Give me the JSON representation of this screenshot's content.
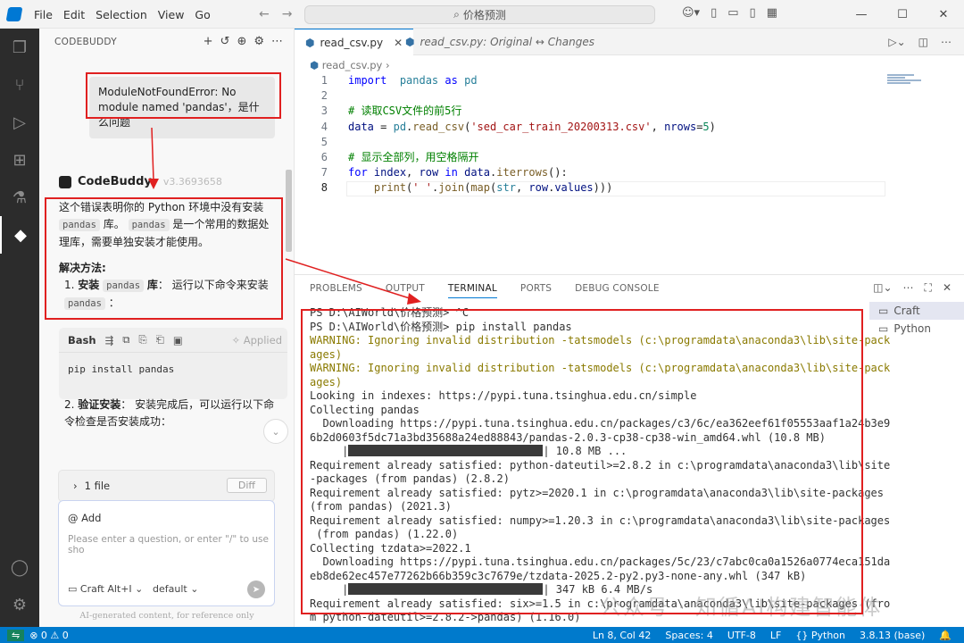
{
  "titlebar": {
    "menu": [
      "File",
      "Edit",
      "Selection",
      "View",
      "Go"
    ],
    "search": "价格预测"
  },
  "sidebar": {
    "title": "CODEBUDDY",
    "user_question": "ModuleNotFoundError: No module named 'pandas'，是什么问题",
    "assistant_name": "CodeBuddy",
    "assistant_version": "v3.3693658",
    "answer": {
      "p1_a": "这个错误表明你的 Python 环境中没有安装",
      "chip1": "pandas",
      "p1_b": "库。",
      "chip2": "pandas",
      "p1_c": "是一个常用的数据处理库，需要单独安装才能使用。",
      "solution_heading": "解决方法:",
      "step1_num": "1.",
      "step1_bold": "安装",
      "step1_chip": "pandas",
      "step1_bold2": "库",
      "step1_text": "： 运行以下命令来安装",
      "step1_chip2": "pandas",
      "step1_end": "："
    },
    "codeblock": {
      "lang": "Bash",
      "applied": "Applied",
      "code": "pip install pandas"
    },
    "step2": {
      "num": "2.",
      "bold": "验证安装",
      "text": "： 安装完成后，可以运行以下命令检查是否安装成功："
    },
    "files": {
      "label": "1 file",
      "diff": "Diff"
    },
    "chat": {
      "at": "@ Add",
      "placeholder": "Please enter a question, or enter \"/\" to use sho",
      "mode": "Craft Alt+I",
      "model": "default"
    },
    "disclaimer": "AI-generated content, for reference only"
  },
  "tabs": [
    {
      "label": "read_csv.py"
    },
    {
      "label": "read_csv.py: Original ↔ Changes"
    }
  ],
  "breadcrumb": "read_csv.py",
  "editor_lines": [
    {
      "n": "1",
      "code": [
        [
          "kw",
          "import"
        ],
        [
          "",
          "  "
        ],
        [
          "bi",
          "pandas"
        ],
        [
          "",
          " "
        ],
        [
          "kw",
          "as"
        ],
        [
          "",
          " "
        ],
        [
          "bi",
          "pd"
        ]
      ]
    },
    {
      "n": "2",
      "code": []
    },
    {
      "n": "3",
      "code": [
        [
          "cm",
          "# 读取CSV文件的前5行"
        ]
      ]
    },
    {
      "n": "4",
      "code": [
        [
          "var",
          "data"
        ],
        [
          "",
          " = "
        ],
        [
          "bi",
          "pd"
        ],
        [
          "",
          "."
        ],
        [
          "fn",
          "read_csv"
        ],
        [
          "",
          "("
        ],
        [
          "str",
          "'sed_car_train_20200313.csv'"
        ],
        [
          "",
          ", "
        ],
        [
          "var",
          "nrows"
        ],
        [
          "",
          "="
        ],
        [
          "num",
          "5"
        ],
        [
          "",
          ")"
        ]
      ]
    },
    {
      "n": "5",
      "code": []
    },
    {
      "n": "6",
      "code": [
        [
          "cm",
          "# 显示全部列，用空格隔开"
        ]
      ]
    },
    {
      "n": "7",
      "code": [
        [
          "kw",
          "for"
        ],
        [
          "",
          " "
        ],
        [
          "var",
          "index"
        ],
        [
          "",
          ", "
        ],
        [
          "var",
          "row"
        ],
        [
          "",
          " "
        ],
        [
          "kw",
          "in"
        ],
        [
          "",
          " "
        ],
        [
          "var",
          "data"
        ],
        [
          "",
          "."
        ],
        [
          "fn",
          "iterrows"
        ],
        [
          "",
          "():"
        ]
      ]
    },
    {
      "n": "8",
      "code": [
        [
          "",
          "    "
        ],
        [
          "fn",
          "print"
        ],
        [
          "",
          "("
        ],
        [
          "str",
          "' '"
        ],
        [
          "",
          "."
        ],
        [
          "fn",
          "join"
        ],
        [
          "",
          "("
        ],
        [
          "fn",
          "map"
        ],
        [
          "",
          "("
        ],
        [
          "bi",
          "str"
        ],
        [
          "",
          ", "
        ],
        [
          "var",
          "row"
        ],
        [
          "",
          "."
        ],
        [
          "var",
          "values"
        ],
        [
          "",
          ")))"
        ]
      ]
    }
  ],
  "panel": {
    "tabs": [
      "PROBLEMS",
      "OUTPUT",
      "TERMINAL",
      "PORTS",
      "DEBUG CONSOLE"
    ],
    "active_tab": "TERMINAL",
    "terminals": [
      "Craft",
      "Python"
    ]
  },
  "terminal_lines": [
    {
      "t": "n",
      "s": "PS D:\\AIWorld\\价格预测> ^C"
    },
    {
      "t": "n",
      "s": "PS D:\\AIWorld\\价格预测> pip install pandas"
    },
    {
      "t": "w",
      "s": "WARNING: Ignoring invalid distribution -tatsmodels (c:\\programdata\\anaconda3\\lib\\site-pack"
    },
    {
      "t": "w",
      "s": "ages)"
    },
    {
      "t": "w",
      "s": "WARNING: Ignoring invalid distribution -tatsmodels (c:\\programdata\\anaconda3\\lib\\site-pack"
    },
    {
      "t": "w",
      "s": "ages)"
    },
    {
      "t": "n",
      "s": "Looking in indexes: https://pypi.tuna.tsinghua.edu.cn/simple"
    },
    {
      "t": "n",
      "s": "Collecting pandas"
    },
    {
      "t": "n",
      "s": "  Downloading https://pypi.tuna.tsinghua.edu.cn/packages/c3/6c/ea362eef61f05553aaf1a24b3e9"
    },
    {
      "t": "n",
      "s": "6b2d0603f5dc71a3bd35688a24ed88843/pandas-2.0.3-cp38-cp38-win_amd64.whl (10.8 MB)"
    },
    {
      "t": "p",
      "s": "     |",
      "e": "| 10.8 MB ..."
    },
    {
      "t": "n",
      "s": "Requirement already satisfied: python-dateutil>=2.8.2 in c:\\programdata\\anaconda3\\lib\\site"
    },
    {
      "t": "n",
      "s": "-packages (from pandas) (2.8.2)"
    },
    {
      "t": "n",
      "s": "Requirement already satisfied: pytz>=2020.1 in c:\\programdata\\anaconda3\\lib\\site-packages"
    },
    {
      "t": "n",
      "s": "(from pandas) (2021.3)"
    },
    {
      "t": "n",
      "s": "Requirement already satisfied: numpy>=1.20.3 in c:\\programdata\\anaconda3\\lib\\site-packages"
    },
    {
      "t": "n",
      "s": " (from pandas) (1.22.0)"
    },
    {
      "t": "n",
      "s": "Collecting tzdata>=2022.1"
    },
    {
      "t": "n",
      "s": "  Downloading https://pypi.tuna.tsinghua.edu.cn/packages/5c/23/c7abc0ca0a1526a0774eca151da"
    },
    {
      "t": "n",
      "s": "eb8de62ec457e77262b66b359c3c7679e/tzdata-2025.2-py2.py3-none-any.whl (347 kB)"
    },
    {
      "t": "p",
      "s": "     |",
      "e": "| 347 kB 6.4 MB/s"
    },
    {
      "t": "n",
      "s": "Requirement already satisfied: six>=1.5 in c:\\programdata\\anaconda3\\lib\\site-packages (fro"
    },
    {
      "t": "n",
      "s": "m python-dateutil>=2.8.2->pandas) (1.16.0)"
    }
  ],
  "status": {
    "problems": "⊗ 0 ⚠ 0",
    "ln_col": "Ln 8, Col 42",
    "spaces": "Spaces: 4",
    "encoding": "UTF-8",
    "eol": "LF",
    "lang": "{} Python",
    "interp": "3.8.13 (base)"
  },
  "watermark": "公众号 · 知循AI构建智能体"
}
